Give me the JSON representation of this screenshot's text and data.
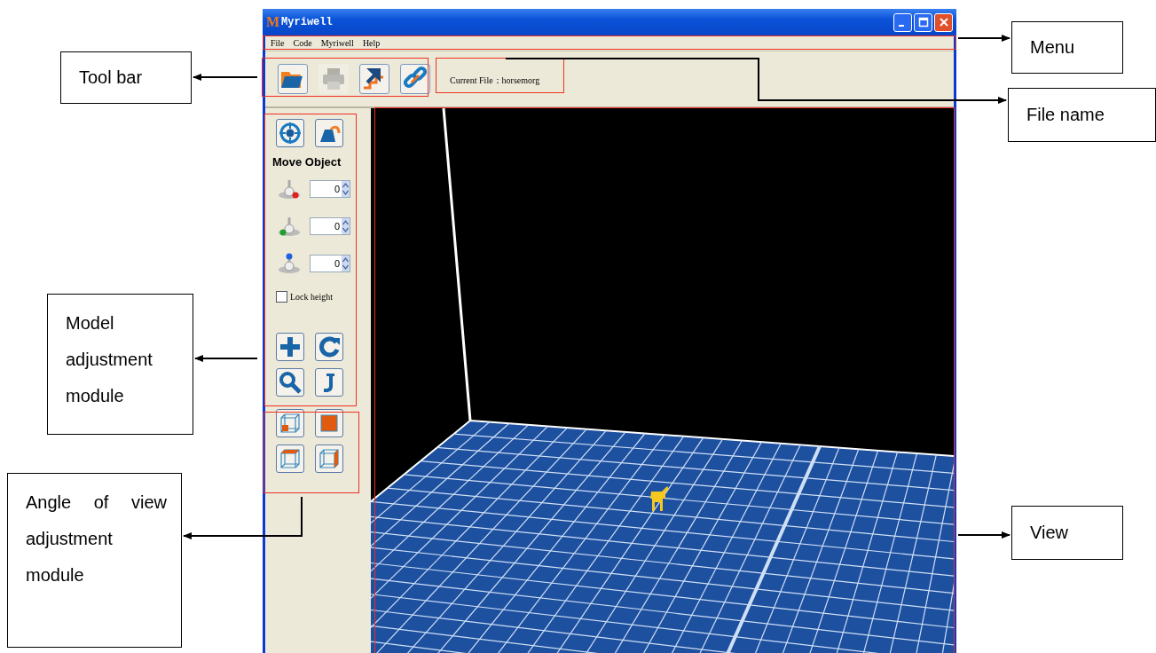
{
  "window": {
    "logo": "M",
    "title": "Myriwell"
  },
  "menu": [
    {
      "label": "File"
    },
    {
      "label": "Code"
    },
    {
      "label": "Myriwell"
    },
    {
      "label": "Help"
    }
  ],
  "toolbar": {
    "buttons": [
      {
        "disabled": false
      },
      {
        "disabled": true
      },
      {
        "disabled": false
      },
      {
        "disabled": false
      }
    ],
    "current_file": "Current File：horsemorg"
  },
  "side_panel": {
    "section_title": "Move Object",
    "axis_inputs": [
      {
        "color": "#e02020",
        "value": "0"
      },
      {
        "color": "#20a030",
        "value": "0"
      },
      {
        "color": "#2060e0",
        "value": "0"
      }
    ],
    "lock_height": {
      "label": "Lock height",
      "checked": false
    }
  },
  "callouts": [
    {
      "text": "Tool bar"
    },
    {
      "text": "Menu"
    },
    {
      "text": "File name"
    },
    {
      "text": "Model adjustment module"
    },
    {
      "text": "Angle of view adjustment module"
    },
    {
      "text": "View"
    }
  ]
}
